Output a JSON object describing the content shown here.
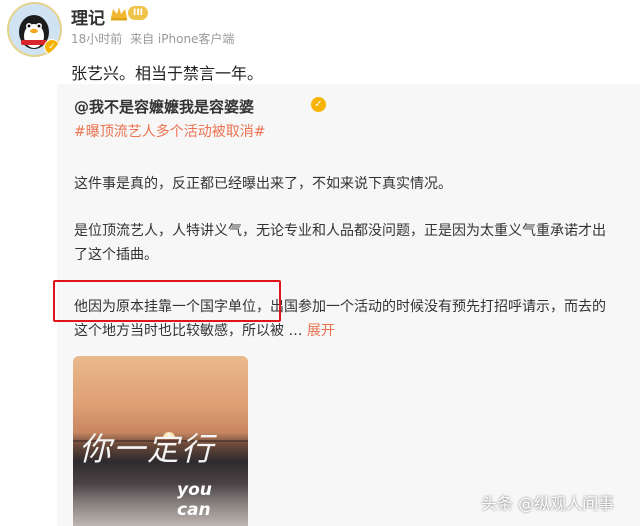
{
  "post": {
    "author": "理记",
    "level_badge": "III",
    "time": "18小时前",
    "source": "来自 iPhone客户端",
    "text": "张艺兴。相当于禁言一年。"
  },
  "repost": {
    "user": "@我不是容嬷嬷我是容婆婆",
    "hashtag": "#曝顶流艺人多个活动被取消#",
    "paragraphs": {
      "p1": "这件事是真的，反正都已经曝出来了，不如来说下真实情况。",
      "p2_line1": "是位顶流艺人，人特讲义气，无论专业和人品都没问题，正是因为太重义气重承诺才出",
      "p2_line2": "了这个插曲。",
      "p3_line1": "他因为原本挂靠一个国字单位，出国参加一个活动的时候没有预先打招呼请示，而去的",
      "p3_line2": "这个地方当时也比较敏感，所以被 … ",
      "expand": "展开"
    },
    "image": {
      "script_text": "你一定行",
      "sub_text": "you can"
    }
  },
  "watermark": "头条 @纵观人间事",
  "colors": {
    "accent": "#eb7350",
    "highlight_box": "#e0141b"
  }
}
